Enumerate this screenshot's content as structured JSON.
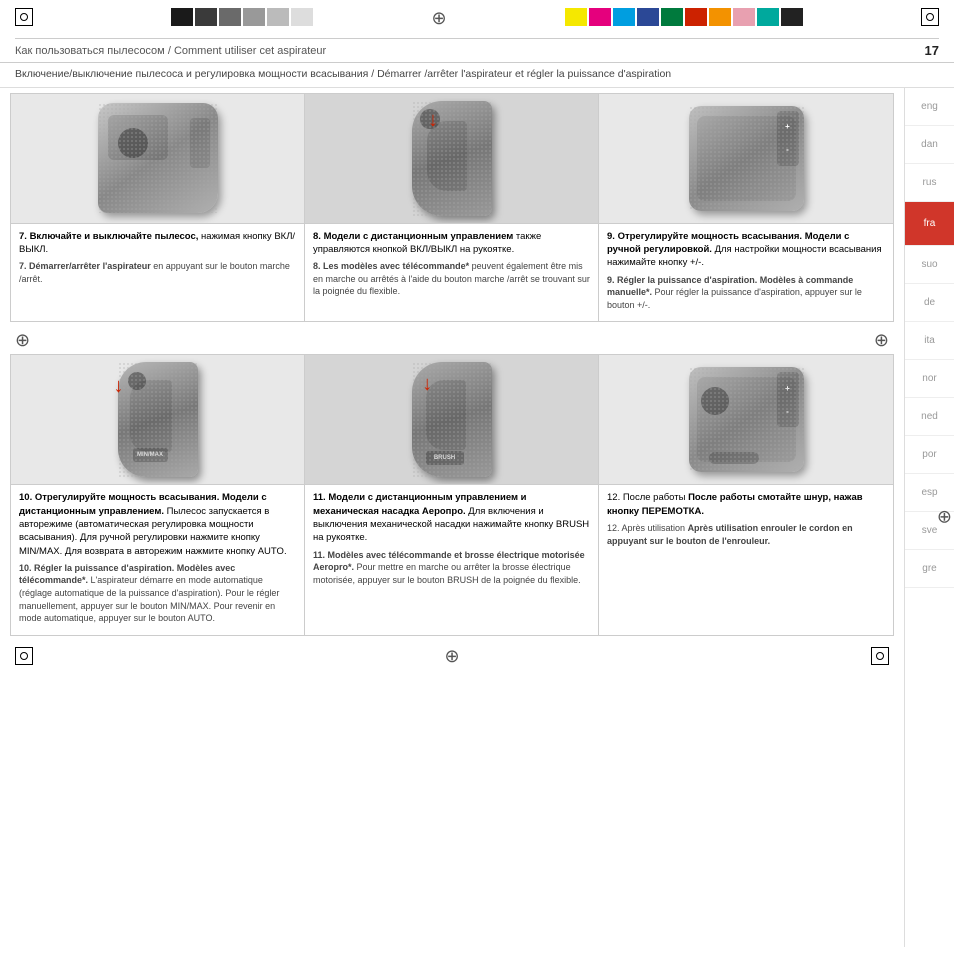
{
  "page": {
    "number": "17",
    "header_ru": "Как пользоваться пылесосом",
    "header_fr": "Comment utiliser cet aspirateur",
    "subheader_ru": "Включение/выключение пылесоса и регулировка мощности всасывания",
    "subheader_fr": "Démarrer /arrêter l'aspirateur et régler la puissance d'aspiration"
  },
  "languages": [
    {
      "code": "eng",
      "active": false
    },
    {
      "code": "dan",
      "active": false
    },
    {
      "code": "rus",
      "active": false
    },
    {
      "code": "fra",
      "active": true,
      "color": "red"
    },
    {
      "code": "suo",
      "active": false
    },
    {
      "code": "de",
      "active": false
    },
    {
      "code": "ita",
      "active": false
    },
    {
      "code": "nor",
      "active": false
    },
    {
      "code": "ned",
      "active": false
    },
    {
      "code": "por",
      "active": false
    },
    {
      "code": "esp",
      "active": false
    },
    {
      "code": "sve",
      "active": false
    },
    {
      "code": "gre",
      "active": false
    }
  ],
  "top_instructions": [
    {
      "id": 7,
      "ru_title": "Включайте и выключайте пылесос,",
      "ru_text": "нажимая кнопку ВКЛ/ВЫКЛ.",
      "fr_title": "Démarrer/arrêter l'aspirateur",
      "fr_text": "en appuyant sur le bouton marche /arrêt."
    },
    {
      "id": 8,
      "ru_title": "Модели с дистанционным управлением",
      "ru_text": "также управляются кнопкой ВКЛ/ВЫКЛ на рукоятке.",
      "fr_title": "Les modèles avec télécommande*",
      "fr_text": "peuvent également être mis en marche ou arrêtés à l'aide du bouton marche /arrêt se trouvant sur la poignée du flexible."
    },
    {
      "id": 9,
      "ru_title": "Отрегулируйте мощность всасывания. Модели с ручной регулировкой.",
      "ru_text": "Для настройки мощности всасывания нажимайте кнопку +/-.",
      "fr_title": "Régler la puissance d'aspiration. Modèles à commande manuelle*.",
      "fr_text": "Pour régler la puissance d'aspiration, appuyer sur le bouton +/-."
    }
  ],
  "bottom_instructions": [
    {
      "id": 10,
      "ru_title": "Отрегулируйте мощность всасывания. Модели с дистанционным управлением.",
      "ru_text": "Пылесос запускается в авторежиме (автоматическая регулировка мощности всасывания). Для ручной регулировки нажмите кнопку MIN/MAX. Для возврата в авторежим нажмите кнопку AUTO.",
      "fr_title": "Régler la puissance d'aspiration. Modèles avec télécommande*.",
      "fr_text": "L'aspirateur démarre en mode automatique (réglage automatique de la puissance d'aspiration). Pour le régler manuellement, appuyer sur le bouton MIN/MAX. Pour revenir en mode automatique, appuyer sur le bouton AUTO."
    },
    {
      "id": 11,
      "ru_title": "Модели с дистанционным управлением и механическая насадка Аеропро.",
      "ru_text": "Для включения и выключения механической насадки нажимайте кнопку BRUSH на рукоятке.",
      "fr_title": "Modèles avec télécommande et brosse électrique motorisée Aeropro*.",
      "fr_text": "Pour mettre en marche ou arrêter la brosse électrique motorisée, appuyer sur le bouton BRUSH de la poignée du flexible."
    },
    {
      "id": 12,
      "ru_title": "После работы смотайте шнур, нажав кнопку ПЕРЕМОТКА.",
      "ru_text": "",
      "fr_title": "Après utilisation enrouler le cordon en appuyant sur le bouton de l'enrouleur.",
      "fr_text": ""
    }
  ]
}
